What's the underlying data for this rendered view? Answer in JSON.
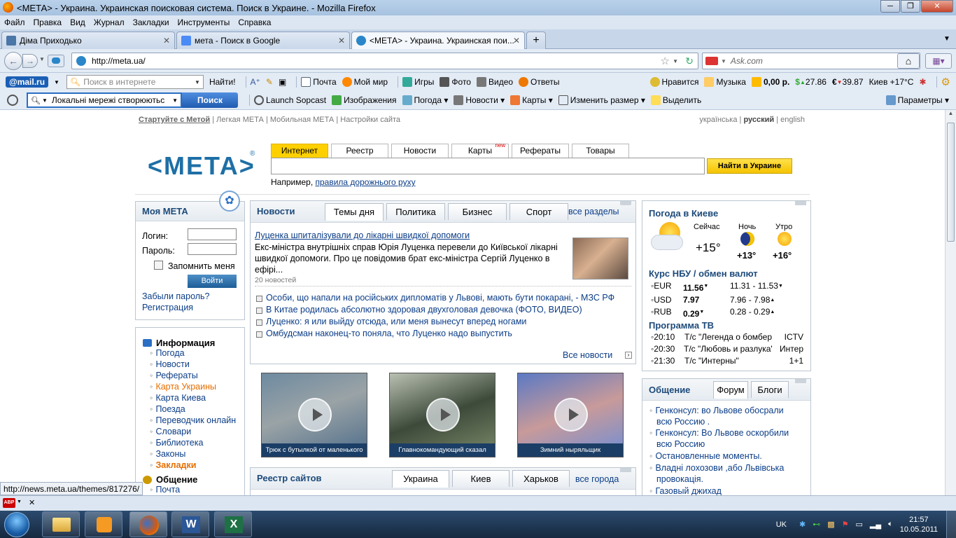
{
  "window": {
    "title": "<МЕТА> - Украина. Украинская поисковая система. Поиск в Украине. - Mozilla Firefox"
  },
  "menu": [
    "Файл",
    "Правка",
    "Вид",
    "Журнал",
    "Закладки",
    "Инструменты",
    "Справка"
  ],
  "tabs": [
    {
      "label": "Діма Приходько",
      "icon_color": "#4a76a8"
    },
    {
      "label": "мета - Поиск в Google",
      "icon_color": "#4b8bf5"
    },
    {
      "label": "<МЕТА> - Украина. Украинская пои...",
      "icon_color": "#2a86c9"
    }
  ],
  "nav": {
    "url": "http://meta.ua/",
    "search_placeholder": "Ask.com"
  },
  "mailru_toolbar": {
    "search_placeholder": "Поиск в интернете",
    "find_label": "Найти!",
    "items": [
      "Почта",
      "Мой мир",
      "Игры",
      "Фото",
      "Видео",
      "Ответы"
    ],
    "right": {
      "like": "Нравится",
      "music": "Музыка",
      "balance": "0,00 р.",
      "usd": "27.86",
      "eur": "39.87",
      "city": "Киев +17°C"
    }
  },
  "meta_toolbar": {
    "search_value": "Локальні мережі створюютьс",
    "search_btn": "Поиск",
    "items": [
      "Launch Sopcast",
      "Изображения",
      "Погода",
      "Новости",
      "Карты",
      "Изменить размер",
      "Выделить"
    ],
    "params": "Параметры"
  },
  "page": {
    "top_links": {
      "start": "Стартуйте с Метой",
      "light": "Легкая МЕТА",
      "mobile": "Мобильная МЕТА",
      "settings": "Настройки сайта"
    },
    "langs": {
      "ua": "українська",
      "ru": "русский",
      "en": "english"
    },
    "logo": "<МЕТА>",
    "search_tabs": [
      "Интернет",
      "Реестр",
      "Новости",
      "Карты",
      "Рефераты",
      "Товары"
    ],
    "new_badge": "new",
    "search_button": "Найти в Украине",
    "example_prefix": "Например,",
    "example_link": "правила дорожнього руху",
    "my_meta": {
      "title": "Моя МЕТА",
      "login": "Логин:",
      "password": "Пароль:",
      "remember": "Запомнить меня",
      "enter": "Войти",
      "forgot": "Забыли пароль?",
      "register": "Регистрация"
    },
    "news": {
      "title": "Новости",
      "tabs": [
        "Темы дня",
        "Политика",
        "Бизнес",
        "Спорт"
      ],
      "all_sections": "все разделы",
      "headline": "Луценка шпиталізували до лікарні швидкої допомоги",
      "lead": "Екс-міністра внутрішніх справ Юрія Луценка перевели до Київської лікарні швидкої допомоги. Про це повідомив брат екс-міністра Сергій Луценко в ефірі...",
      "count": "20 новостей",
      "items": [
        "Особи, що напали на російських дипломатів у Львові, мають бути покарані, - МЗС РФ",
        "В Китае родилась абсолютно здоровая двухголовая девочка (ФОТО, ВИДЕО)",
        "Луценко: я или выйду отсюда, или меня вынесут вперед ногами",
        "Омбудсман наконец-то поняла, что Луценко надо выпустить"
      ],
      "all_news": "Все новости"
    },
    "videos": [
      "Трюк с бутылкой от маленького",
      "Главнокомандующий сказал",
      "Зимний ныряльщик"
    ],
    "info": {
      "title": "Информация",
      "items": [
        "Погода",
        "Новости",
        "Рефераты",
        "Карта Украины",
        "Карта Киева",
        "Поезда",
        "Переводчик онлайн",
        "Словари",
        "Библиотека",
        "Законы",
        "Закладки"
      ],
      "orange": [
        3,
        10
      ],
      "comm_title": "Общение",
      "comm_items": [
        "Почта"
      ]
    },
    "weather": {
      "title": "Погода в Киеве",
      "now_label": "Сейчас",
      "night_label": "Ночь",
      "morning_label": "Утро",
      "now": "+15°",
      "night": "+13°",
      "morning": "+16°"
    },
    "rates": {
      "title": "Курс НБУ / обмен валют",
      "rows": [
        {
          "cur": "EUR",
          "nbu": "11.56",
          "range": "11.31 - 11.53"
        },
        {
          "cur": "USD",
          "nbu": "7.97",
          "range": "7.96 - 7.98"
        },
        {
          "cur": "RUB",
          "nbu": "0.29",
          "range": "0.28 - 0.29"
        }
      ]
    },
    "tv": {
      "title": "Программа ТВ",
      "rows": [
        {
          "time": "20:10",
          "show": "Т/с \"Легенда о бомбер",
          "ch": "ICTV"
        },
        {
          "time": "20:30",
          "show": "Т/с \"Любовь и разлука'",
          "ch": "Интер"
        },
        {
          "time": "21:30",
          "show": "Т/с \"Интерны\"",
          "ch": "1+1"
        }
      ]
    },
    "community": {
      "title": "Общение",
      "tabs": [
        "Форум",
        "Блоги"
      ],
      "items": [
        "Генконсул: во Львове обосрали всю Россию .",
        "Генконсул: Во Львове оскорбили всю Россию",
        "Остановленные моменты.",
        "Владні лохозови ,або Львівська провокація.",
        "Газовый джихад"
      ]
    },
    "registry": {
      "title": "Реестр сайтов",
      "tabs": [
        "Украина",
        "Киев",
        "Харьков"
      ],
      "all_cities": "все города"
    }
  },
  "status": {
    "url": "http://news.meta.ua/themes/817276/"
  },
  "tray": {
    "lang": "UK",
    "time": "21:57",
    "date": "10.05.2011"
  }
}
